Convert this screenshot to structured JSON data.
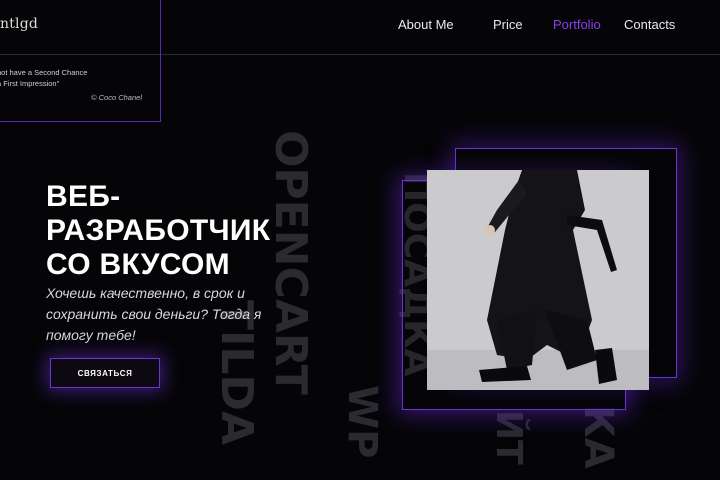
{
  "logo": {
    "text": "ntlgd"
  },
  "nav": {
    "items": [
      {
        "label": "About Me"
      },
      {
        "label": "Price"
      },
      {
        "label": "Portfolio"
      },
      {
        "label": "Contacts"
      }
    ],
    "active_color": "#8a3ff0"
  },
  "quote": {
    "line1": "not have a Second Chance",
    "line2": "a First Impression\"",
    "author": "© Coco Chanel"
  },
  "hero": {
    "title_line1": "ВЕБ-",
    "title_line2": "РАЗРАБОТЧИК",
    "title_line3": "СО ВКУСОМ",
    "subtitle": "Хочешь качественно, в срок и сохранить свои деньги? Тогда я помогу тебе!",
    "cta_label": "СВЯЗАТЬСЯ"
  },
  "background_words": {
    "word1": "OPENCART",
    "word2": "TILDA",
    "word3": "ПОСАДКА",
    "word4": "WP",
    "word5": "КА",
    "word6": "ЙТ"
  },
  "colors": {
    "background": "#050507",
    "accent": "#6b33d6",
    "text": "#ffffff"
  }
}
